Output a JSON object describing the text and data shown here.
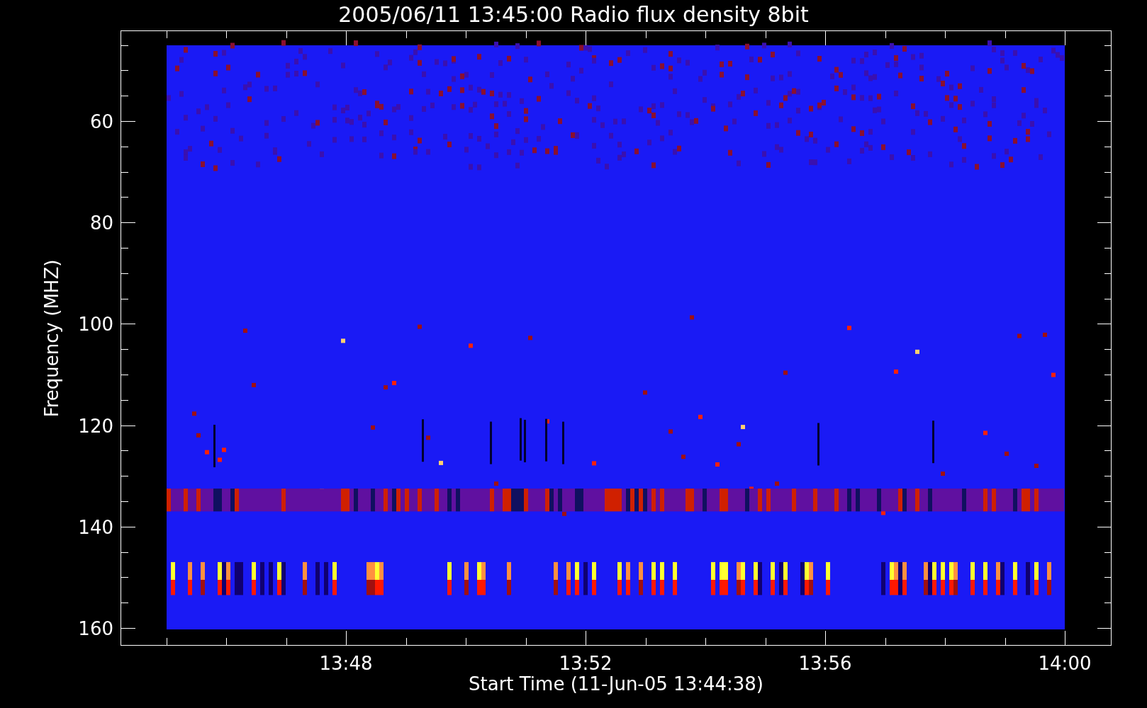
{
  "title": "2005/06/11 13:45:00 Radio flux density 8bit",
  "y_axis": {
    "label": "Frequency (MHZ)",
    "ticks": [
      "60",
      "80",
      "100",
      "120",
      "140",
      "160"
    ]
  },
  "x_axis": {
    "label": "Start Time (11-Jun-05 13:44:38)",
    "ticks": [
      "13:48",
      "13:52",
      "13:56",
      "14:00"
    ]
  }
}
